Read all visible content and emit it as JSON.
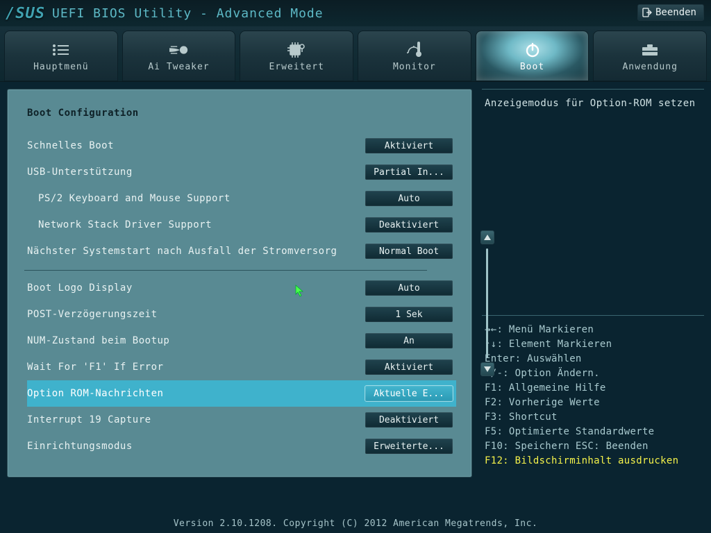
{
  "title": {
    "brand": "/SUS",
    "text": "UEFI BIOS Utility - Advanced Mode"
  },
  "exit": {
    "label": "Beenden"
  },
  "tabs": [
    {
      "label": "Hauptmenü"
    },
    {
      "label": "Ai Tweaker"
    },
    {
      "label": "Erweitert"
    },
    {
      "label": "Monitor"
    },
    {
      "label": "Boot"
    },
    {
      "label": "Anwendung"
    }
  ],
  "section_title": "Boot Configuration",
  "rows": [
    {
      "label": "Schnelles Boot",
      "value": "Aktiviert"
    },
    {
      "label": "USB-Unterstützung",
      "value": "Partial In..."
    },
    {
      "label": "PS/2 Keyboard and Mouse Support",
      "value": "Auto"
    },
    {
      "label": "Network Stack Driver Support",
      "value": "Deaktiviert"
    },
    {
      "label": "Nächster Systemstart nach Ausfall der Stromversorg",
      "value": "Normal Boot"
    },
    {
      "label": "Boot Logo Display",
      "value": "Auto"
    },
    {
      "label": "POST-Verzögerungszeit",
      "value": "1 Sek"
    },
    {
      "label": "NUM-Zustand beim Bootup",
      "value": "An"
    },
    {
      "label": "Wait For 'F1' If Error",
      "value": "Aktiviert"
    },
    {
      "label": "Option ROM-Nachrichten",
      "value": "Aktuelle E..."
    },
    {
      "label": "Interrupt 19 Capture",
      "value": "Deaktiviert"
    },
    {
      "label": "Einrichtungsmodus",
      "value": "Erweiterte..."
    }
  ],
  "help": {
    "desc": "Anzeigemodus für Option-ROM setzen",
    "keys": {
      "l1": "→←: Menü Markieren",
      "l2": "↑↓: Element Markieren",
      "l3": "Enter: Auswählen",
      "l4": "+/-: Option Ändern.",
      "l5": "F1: Allgemeine Hilfe",
      "l6": "F2: Vorherige Werte",
      "l7": "F3: Shortcut",
      "l8": "F5: Optimierte Standardwerte",
      "l9": "F10: Speichern  ESC: Beenden",
      "l10": "F12: Bildschirminhalt ausdrucken"
    }
  },
  "footer": "Version 2.10.1208. Copyright (C) 2012 American Megatrends, Inc."
}
